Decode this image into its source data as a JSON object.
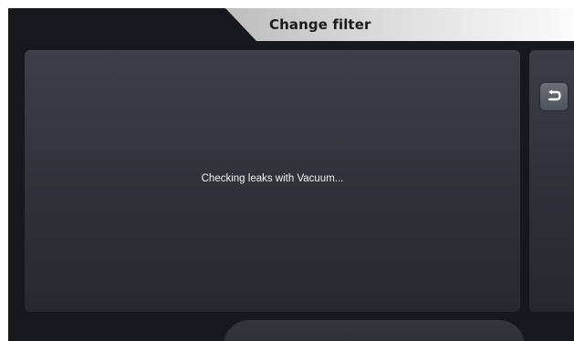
{
  "header": {
    "title": "Change filter"
  },
  "main": {
    "status_message": "Checking leaks with Vacuum..."
  },
  "side": {
    "back_icon": "return-arrow-icon"
  },
  "colors": {
    "background": "#16181d",
    "panel": "#33363c",
    "title_tab_start": "#bdbdbd",
    "title_tab_end": "#fbfbfb",
    "text_light": "#f2f2f2",
    "text_dark": "#1a1a1a"
  }
}
